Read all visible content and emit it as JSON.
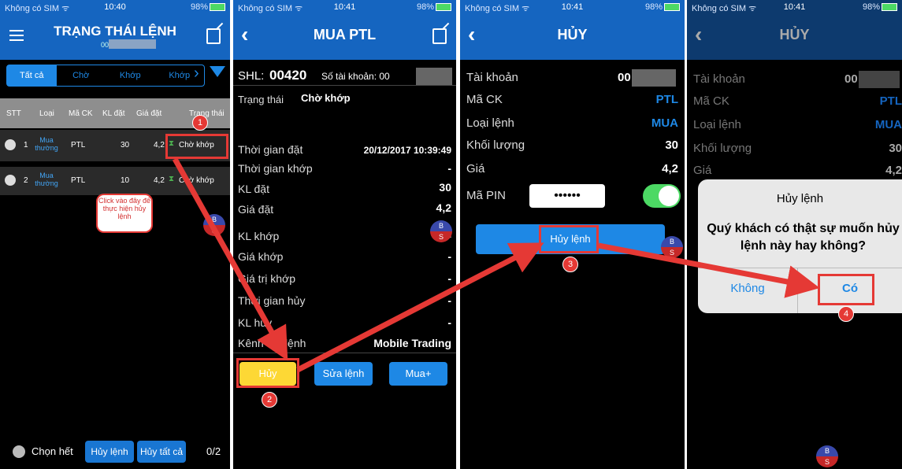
{
  "screen1": {
    "status": {
      "carrier": "Không có SIM ᯤ",
      "time": "10:40",
      "battery": "98%"
    },
    "title": "TRẠNG THÁI LỆNH",
    "subtitle": "00",
    "tabs": [
      "Tất cả",
      "Chờ",
      "Khớp",
      "Khớp"
    ],
    "headers": [
      "STT",
      "Loại",
      "Mã CK",
      "KL đặt",
      "Giá đặt",
      "Trạng thái"
    ],
    "rows": [
      {
        "stt": "1",
        "type": "Mua thường",
        "code": "PTL",
        "qty": "30",
        "price": "4,2",
        "status": "Chờ khớp"
      },
      {
        "stt": "2",
        "type": "Mua thường",
        "code": "PTL",
        "qty": "10",
        "price": "4,2",
        "status": "Chờ khớp"
      }
    ],
    "callout": "Click vào đây để thực hiện hủy lệnh",
    "footer": {
      "select_all": "Chọn hết",
      "cancel_order": "Hủy lệnh",
      "cancel_all": "Hủy tất cả",
      "count": "0/2"
    }
  },
  "screen2": {
    "status": {
      "carrier": "Không có SIM ᯤ",
      "time": "10:41",
      "battery": "98%"
    },
    "title": "MUA  PTL",
    "shl_label": "SHL:",
    "shl_value": "00420",
    "account_label": "Số tài khoản: 00",
    "status_label": "Trạng thái",
    "status_value": "Chờ khớp",
    "fields": [
      {
        "label": "Thời gian đặt",
        "value": "20/12/2017 10:39:49"
      },
      {
        "label": "Thời gian khớp",
        "value": "-"
      },
      {
        "label": "KL đặt",
        "value": "30"
      },
      {
        "label": "Giá đặt",
        "value": "4,2"
      },
      {
        "label": "KL khớp",
        "value": "-"
      },
      {
        "label": "Giá khớp",
        "value": "-"
      },
      {
        "label": "Giá trị khớp",
        "value": "-"
      },
      {
        "label": "Thời gian hủy",
        "value": "-"
      },
      {
        "label": "KL hủy",
        "value": "-"
      },
      {
        "label": "Kênh đặt lệnh",
        "value": "Mobile Trading"
      }
    ],
    "buttons": {
      "cancel": "Hủy",
      "edit": "Sửa lệnh",
      "buy_more": "Mua+"
    }
  },
  "screen3": {
    "status": {
      "carrier": "Không có SIM ᯤ",
      "time": "10:41",
      "battery": "98%"
    },
    "title": "HỦY",
    "fields": [
      {
        "label": "Tài khoản",
        "value": "00"
      },
      {
        "label": "Mã CK",
        "value": "PTL"
      },
      {
        "label": "Loại lệnh",
        "value": "MUA"
      },
      {
        "label": "Khối lượng",
        "value": "30"
      },
      {
        "label": "Giá",
        "value": "4,2"
      }
    ],
    "pin_label": "Mã PIN",
    "pin_value": "••••••",
    "cancel_button": "Hủy lệnh"
  },
  "screen4": {
    "status": {
      "carrier": "Không có SIM ᯤ",
      "time": "10:41",
      "battery": "98%"
    },
    "title": "HỦY",
    "fields": [
      {
        "label": "Tài khoản",
        "value": "00"
      },
      {
        "label": "Mã CK",
        "value": "PTL"
      },
      {
        "label": "Loại lệnh",
        "value": "MUA"
      },
      {
        "label": "Khối lượng",
        "value": "30"
      },
      {
        "label": "Giá",
        "value": "4,2"
      }
    ],
    "dialog": {
      "title": "Hủy lệnh",
      "message": "Quý khách có thật sự muốn hủy lệnh này hay không?",
      "no": "Không",
      "yes": "Có"
    }
  },
  "steps": [
    "1",
    "2",
    "3",
    "4"
  ],
  "bs": {
    "b": "B",
    "s": "S"
  },
  "colors": {
    "nav": "#1565c0",
    "accent_blue": "#1e88e5",
    "annotation_red": "#e53935",
    "highlight_yellow": "#fdd835",
    "toggle_green": "#4cd964"
  }
}
